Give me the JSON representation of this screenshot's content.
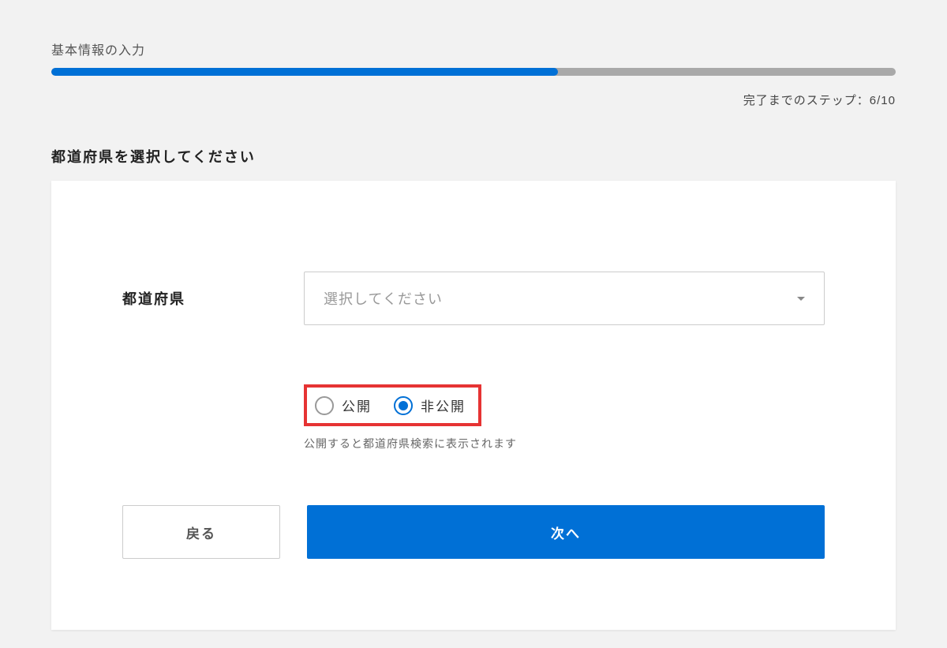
{
  "header": {
    "title": "基本情報の入力",
    "step_text": "完了までのステップ：6/10",
    "progress_percent": 60
  },
  "section": {
    "title": "都道府県を選択してください"
  },
  "form": {
    "prefecture_label": "都道府県",
    "select_placeholder": "選択してください"
  },
  "visibility": {
    "public_label": "公開",
    "private_label": "非公開",
    "selected": "private",
    "hint": "公開すると都道府県検索に表示されます"
  },
  "buttons": {
    "back": "戻る",
    "next": "次へ"
  }
}
